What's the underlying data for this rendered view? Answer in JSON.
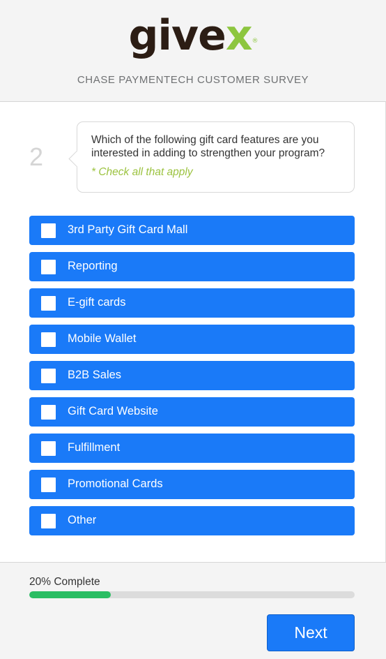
{
  "header": {
    "logo_main": "give",
    "logo_accent": "x",
    "logo_registered": "®",
    "survey_title": "CHASE PAYMENTECH CUSTOMER SURVEY"
  },
  "question": {
    "number": "2",
    "text": "Which of the following gift card features are you interested in adding to strengthen your program?",
    "hint": "* Check all that apply"
  },
  "options": [
    {
      "label": "3rd Party Gift Card Mall",
      "checked": false
    },
    {
      "label": "Reporting",
      "checked": false
    },
    {
      "label": "E-gift cards",
      "checked": false
    },
    {
      "label": "Mobile Wallet",
      "checked": false
    },
    {
      "label": "B2B Sales",
      "checked": false
    },
    {
      "label": "Gift Card Website",
      "checked": false
    },
    {
      "label": "Fulfillment",
      "checked": false
    },
    {
      "label": "Promotional Cards",
      "checked": false
    },
    {
      "label": "Other",
      "checked": false
    }
  ],
  "progress": {
    "label": "20% Complete",
    "percent": 25
  },
  "footer": {
    "next_label": "Next"
  },
  "colors": {
    "option_bg": "#1a7af8",
    "progress_fill": "#2bbd63",
    "hint": "#9cc340",
    "logo_accent": "#8dc63f",
    "logo_main": "#2c1d14"
  }
}
